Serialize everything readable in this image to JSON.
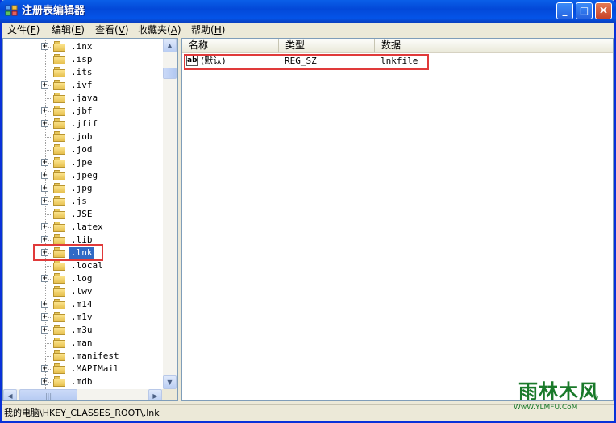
{
  "window": {
    "title": "注册表编辑器",
    "min_glyph": "_",
    "max_glyph": "□",
    "close_glyph": "×"
  },
  "menu": [
    {
      "label": "文件",
      "accel": "F"
    },
    {
      "label": "编辑",
      "accel": "E"
    },
    {
      "label": "查看",
      "accel": "V"
    },
    {
      "label": "收藏夹",
      "accel": "A"
    },
    {
      "label": "帮助",
      "accel": "H"
    }
  ],
  "tree": {
    "items": [
      {
        "label": ".inx",
        "expandable": true
      },
      {
        "label": ".isp",
        "expandable": false
      },
      {
        "label": ".its",
        "expandable": false
      },
      {
        "label": ".ivf",
        "expandable": true
      },
      {
        "label": ".java",
        "expandable": false
      },
      {
        "label": ".jbf",
        "expandable": true
      },
      {
        "label": ".jfif",
        "expandable": true
      },
      {
        "label": ".job",
        "expandable": false
      },
      {
        "label": ".jod",
        "expandable": false
      },
      {
        "label": ".jpe",
        "expandable": true
      },
      {
        "label": ".jpeg",
        "expandable": true
      },
      {
        "label": ".jpg",
        "expandable": true
      },
      {
        "label": ".js",
        "expandable": true
      },
      {
        "label": ".JSE",
        "expandable": false
      },
      {
        "label": ".latex",
        "expandable": true
      },
      {
        "label": ".lib",
        "expandable": true
      },
      {
        "label": ".lnk",
        "expandable": true,
        "selected": true
      },
      {
        "label": ".local",
        "expandable": false
      },
      {
        "label": ".log",
        "expandable": true
      },
      {
        "label": ".lwv",
        "expandable": false
      },
      {
        "label": ".m14",
        "expandable": true
      },
      {
        "label": ".m1v",
        "expandable": true
      },
      {
        "label": ".m3u",
        "expandable": true
      },
      {
        "label": ".man",
        "expandable": false
      },
      {
        "label": ".manifest",
        "expandable": false
      },
      {
        "label": ".MAPIMail",
        "expandable": true
      },
      {
        "label": ".mdb",
        "expandable": true
      }
    ]
  },
  "list": {
    "columns": [
      "名称",
      "类型",
      "数据"
    ],
    "rows": [
      {
        "icon": "ab",
        "name": "(默认)",
        "type": "REG_SZ",
        "data": "lnkfile"
      }
    ]
  },
  "status": "我的电脑\\HKEY_CLASSES_ROOT\\.lnk",
  "watermark": {
    "title": "雨林木风",
    "url": "WwW.YLMFU.CoM"
  },
  "colors": {
    "titlebar": "#0348d8",
    "selection": "#316ac5",
    "highlight_box": "#e03a3a",
    "watermark": "#1a7a2a"
  }
}
